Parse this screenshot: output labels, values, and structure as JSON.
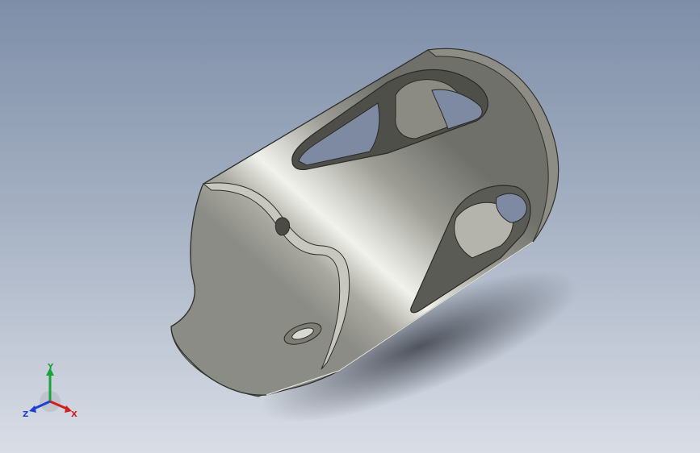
{
  "viewport": {
    "background_top": "#7e8ea8",
    "background_bottom": "#d9dde6"
  },
  "model": {
    "part_type": "cylindrical sleeve with cutouts",
    "material_color": "#9a9a93",
    "highlight_color": "#f4f4ef",
    "shadow_color": "#55564f"
  },
  "triad": {
    "x_label": "X",
    "y_label": "Y",
    "z_label": "Z",
    "x_color": "#d21d1d",
    "y_color": "#1aa33a",
    "z_color": "#1f3fd0"
  }
}
